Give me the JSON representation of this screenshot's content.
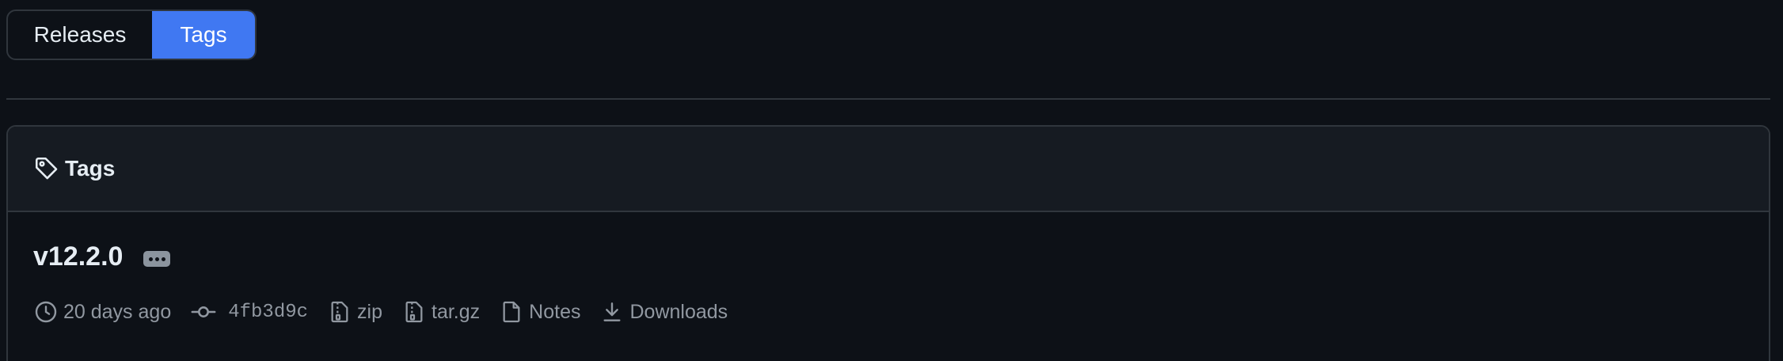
{
  "segmented": {
    "releases_label": "Releases",
    "tags_label": "Tags",
    "active": "Tags"
  },
  "box": {
    "title": "Tags",
    "header_icon": "tag-icon"
  },
  "tag": {
    "name": "v12.2.0",
    "time": "20 days ago",
    "commit": "4fb3d9c",
    "zip": "zip",
    "targz": "tar.gz",
    "notes": "Notes",
    "downloads": "Downloads"
  },
  "colors": {
    "accent": "#4078f2",
    "background": "#0d1117",
    "muted": "#9198a1"
  }
}
